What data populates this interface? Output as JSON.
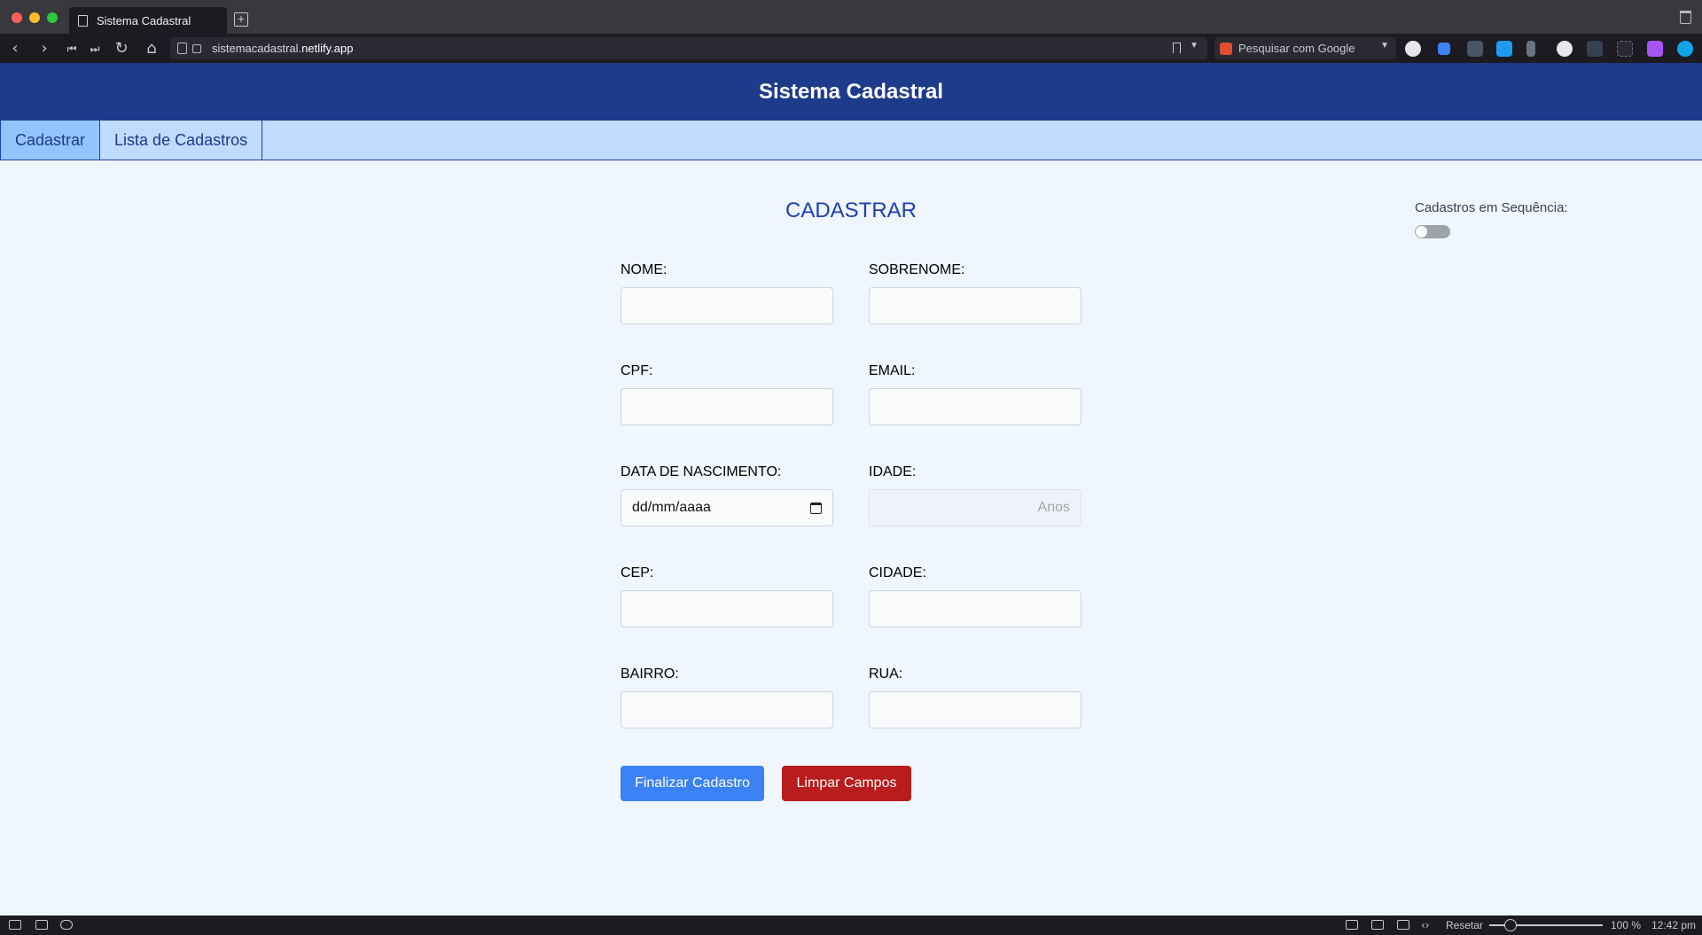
{
  "browser": {
    "tab_title": "Sistema Cadastral",
    "url_host": "sistemacadastral.",
    "url_domain": "netlify.app",
    "search_placeholder": "Pesquisar com Google"
  },
  "app": {
    "title": "Sistema Cadastral",
    "nav": [
      {
        "label": "Cadastrar",
        "active": true
      },
      {
        "label": "Lista de Cadastros",
        "active": false
      }
    ]
  },
  "form": {
    "title": "CADASTRAR",
    "fields": {
      "nome": {
        "label": "NOME:",
        "value": ""
      },
      "sobrenome": {
        "label": "SOBRENOME:",
        "value": ""
      },
      "cpf": {
        "label": "CPF:",
        "value": ""
      },
      "email": {
        "label": "EMAIL:",
        "value": ""
      },
      "nascimento": {
        "label": "DATA DE NASCIMENTO:",
        "value": "dd/mm/aaaa"
      },
      "idade": {
        "label": "IDADE:",
        "placeholder": "Anos"
      },
      "cep": {
        "label": "CEP:",
        "value": ""
      },
      "cidade": {
        "label": "CIDADE:",
        "value": ""
      },
      "bairro": {
        "label": "BAIRRO:",
        "value": ""
      },
      "rua": {
        "label": "RUA:",
        "value": ""
      }
    },
    "submit_label": "Finalizar Cadastro",
    "clear_label": "Limpar Campos"
  },
  "sequence_toggle": {
    "label": "Cadastros em Sequência:",
    "on": false
  },
  "statusbar": {
    "reset_label": "Resetar",
    "zoom": "100 %",
    "time": "12:42 pm"
  },
  "colors": {
    "header": "#1e3a8a",
    "nav": "#bfdbfe",
    "primary": "#3b82f6",
    "danger": "#b91c1c"
  }
}
